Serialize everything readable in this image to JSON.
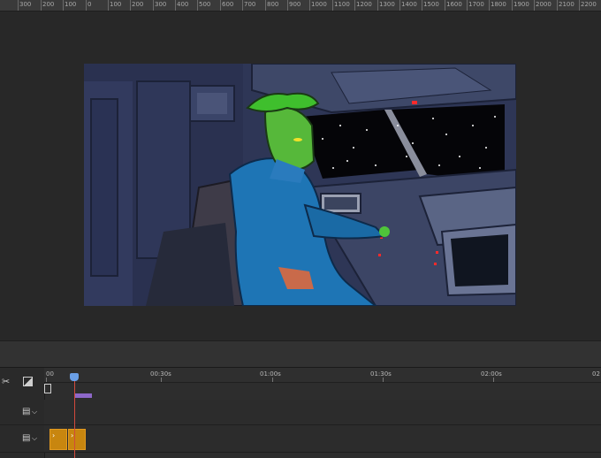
{
  "ruler": {
    "labels": [
      "300",
      "200",
      "100",
      "0",
      "100",
      "200",
      "300",
      "400",
      "500",
      "600",
      "700",
      "800",
      "900",
      "1000",
      "1100",
      "1200",
      "1300",
      "1400",
      "1500",
      "1600",
      "1700",
      "1800",
      "1900",
      "2000",
      "2100",
      "2200"
    ]
  },
  "timeline": {
    "labels": [
      "00",
      "00:30s",
      "01:00s",
      "01:30s",
      "02:00s",
      "02"
    ],
    "scissors_icon": "scissors-icon",
    "transition_icon": "transition-icon"
  },
  "colors": {
    "accent_playhead": "#d24a3c",
    "clip_orange": "#c8860f",
    "clip_purple": "#8e68c9"
  }
}
